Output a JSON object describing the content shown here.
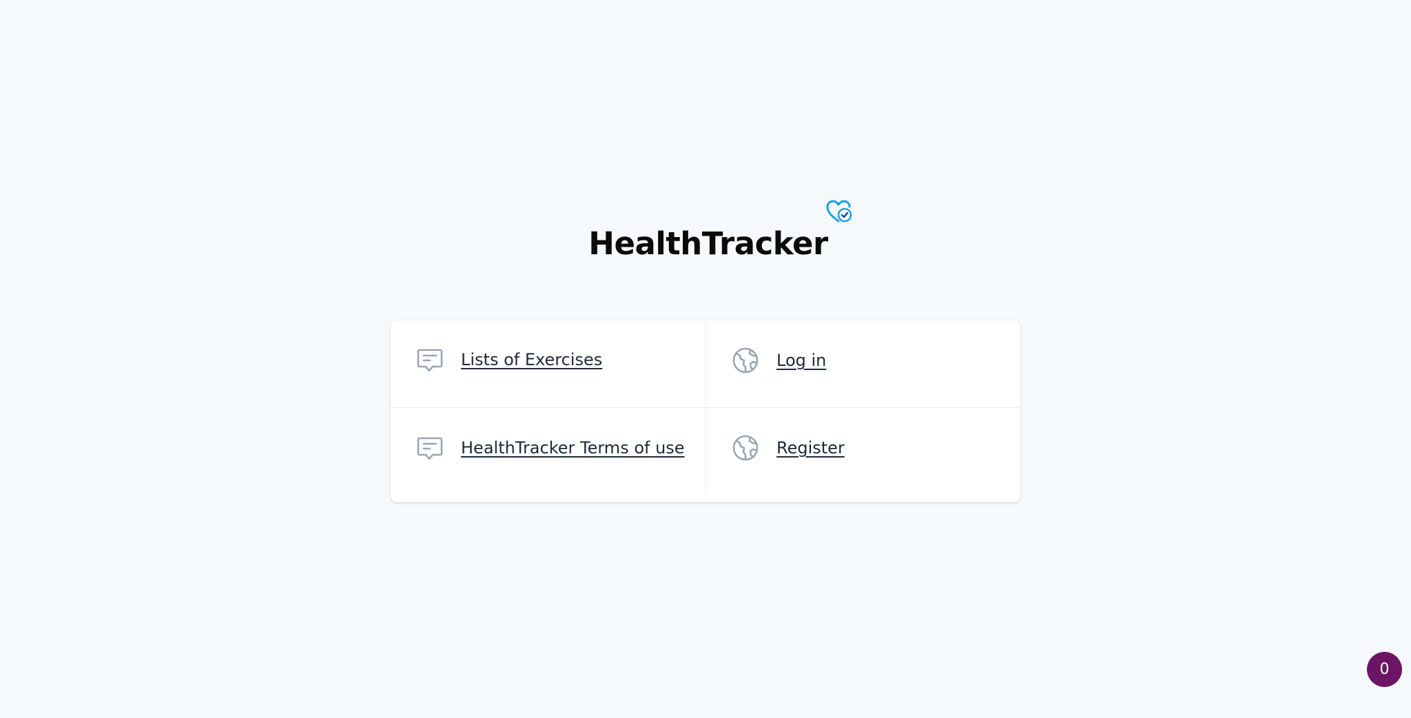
{
  "brand": {
    "title": "HealthTracker",
    "icon": "heart-check-icon",
    "icon_color": "#1aa0e0",
    "check_color": "#1b4fa8"
  },
  "links": [
    {
      "label": "Lists of Exercises",
      "icon": "message-icon"
    },
    {
      "label": "Log in",
      "icon": "globe-icon"
    },
    {
      "label": "HealthTracker Terms of use",
      "icon": "message-icon"
    },
    {
      "label": "Register",
      "icon": "globe-icon"
    }
  ],
  "counter_badge": {
    "value": "0",
    "color": "#6b1565"
  },
  "colors": {
    "background": "#f6f9fc",
    "icon": "#9aa5b4",
    "link_text": "#1f2937"
  }
}
